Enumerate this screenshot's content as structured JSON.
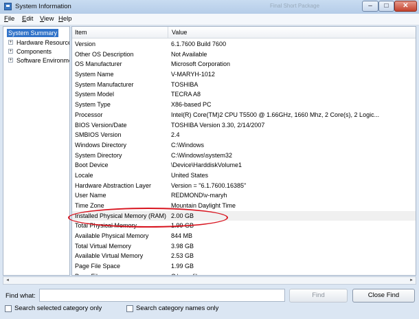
{
  "window": {
    "title": "System Information",
    "ghost_title": "Final Short Package",
    "controls": {
      "minimize": "–",
      "maximize": "□",
      "close": "✕"
    }
  },
  "menu": [
    "File",
    "Edit",
    "View",
    "Help"
  ],
  "tree": {
    "selected": "System Summary",
    "nodes": [
      {
        "label": "Hardware Resources",
        "expander": "+"
      },
      {
        "label": "Components",
        "expander": "+"
      },
      {
        "label": "Software Environment",
        "expander": "+"
      }
    ]
  },
  "list": {
    "headers": {
      "item": "Item",
      "value": "Value"
    },
    "rows": [
      {
        "item": "Version",
        "value": "6.1.7600 Build 7600"
      },
      {
        "item": "Other OS Description",
        "value": "Not Available"
      },
      {
        "item": "OS Manufacturer",
        "value": "Microsoft Corporation"
      },
      {
        "item": "System Name",
        "value": "V-MARYH-1012"
      },
      {
        "item": "System Manufacturer",
        "value": "TOSHIBA"
      },
      {
        "item": "System Model",
        "value": "TECRA A8"
      },
      {
        "item": "System Type",
        "value": "X86-based PC"
      },
      {
        "item": "Processor",
        "value": "Intel(R) Core(TM)2 CPU        T5500  @ 1.66GHz, 1660 Mhz, 2 Core(s), 2 Logic..."
      },
      {
        "item": "BIOS Version/Date",
        "value": "TOSHIBA Version 3.30, 2/14/2007"
      },
      {
        "item": "SMBIOS Version",
        "value": "2.4"
      },
      {
        "item": "Windows Directory",
        "value": "C:\\Windows"
      },
      {
        "item": "System Directory",
        "value": "C:\\Windows\\system32"
      },
      {
        "item": "Boot Device",
        "value": "\\Device\\HarddiskVolume1"
      },
      {
        "item": "Locale",
        "value": "United States"
      },
      {
        "item": "Hardware Abstraction Layer",
        "value": "Version = \"6.1.7600.16385\""
      },
      {
        "item": "User Name",
        "value": "REDMOND\\v-maryh"
      },
      {
        "item": "Time Zone",
        "value": "Mountain Daylight Time"
      },
      {
        "item": "Installed Physical Memory (RAM)",
        "value": "2.00 GB"
      },
      {
        "item": "Total Physical Memory",
        "value": "1.99 GB"
      },
      {
        "item": "Available Physical Memory",
        "value": "844 MB"
      },
      {
        "item": "Total Virtual Memory",
        "value": "3.98 GB"
      },
      {
        "item": "Available Virtual Memory",
        "value": "2.53 GB"
      },
      {
        "item": "Page File Space",
        "value": "1.99 GB"
      },
      {
        "item": "Page File",
        "value": "C:\\pagefile.sys"
      }
    ],
    "highlighted_index": 17
  },
  "scrollbar": {
    "left_arrow": "◂",
    "right_arrow": "▸"
  },
  "find": {
    "label": "Find what:",
    "value": "",
    "find_button": "Find",
    "close_find_button": "Close Find",
    "checkbox_selected_category": "Search selected category only",
    "checkbox_category_names": "Search category names only"
  },
  "colors": {
    "annotation_oval": "#d8141f",
    "selection": "#3173c9"
  }
}
